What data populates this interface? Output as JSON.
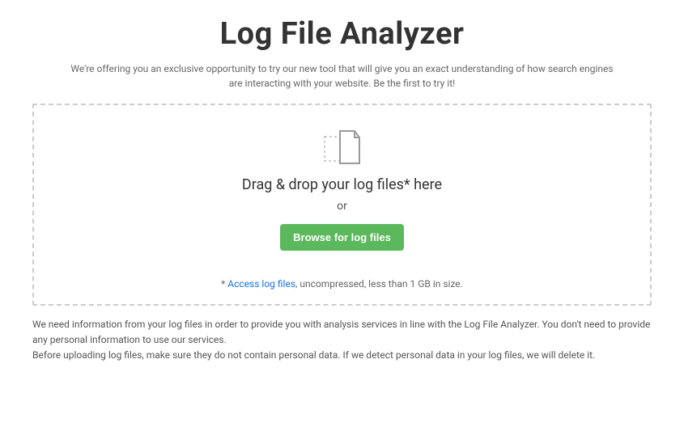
{
  "header": {
    "title": "Log File Analyzer",
    "subtitle": "We're offering you an exclusive opportunity to try our new tool that will give you an exact understanding of how search engines are interacting with your website. Be the first to try it!"
  },
  "dropzone": {
    "drop_label": "Drag & drop your log files* here",
    "or_label": "or",
    "browse_label": "Browse for log files",
    "footnote_prefix": "* ",
    "footnote_link": "Access log files",
    "footnote_suffix": ", uncompressed, less than 1 GB in size."
  },
  "legal": {
    "p1": "We need information from your log files in order to provide you with analysis services in line with the Log File Analyzer. You don't need to provide any personal information to use our services.",
    "p2": "Before uploading log files, make sure they do not contain personal data. If we detect personal data in your log files, we will delete it."
  },
  "colors": {
    "accent": "#5cb85c",
    "link": "#1a73e8"
  }
}
